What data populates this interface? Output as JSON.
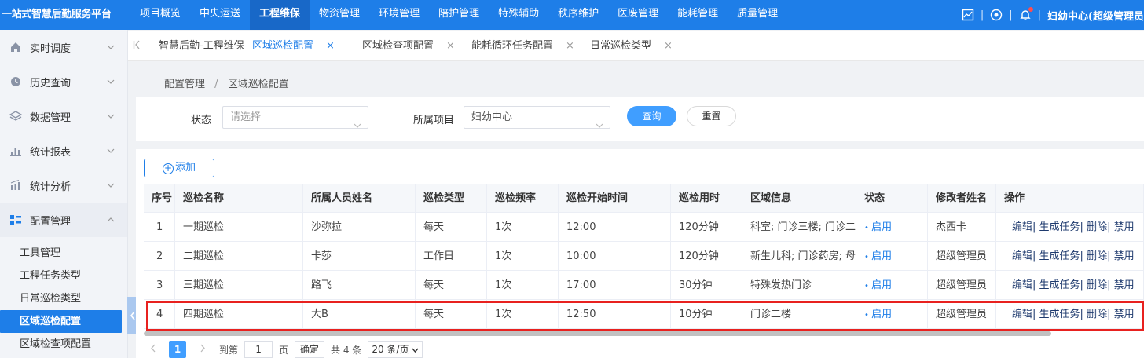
{
  "topbar": {
    "brand": "一站式智慧后勤服务平台",
    "nav": [
      "项目概览",
      "中央运送",
      "工程维保",
      "物资管理",
      "环境管理",
      "陪护管理",
      "特殊辅助",
      "秩序维护",
      "医废管理",
      "能耗管理",
      "质量管理"
    ],
    "active_nav": "工程维保",
    "user_label": "妇幼中心(超级管理员"
  },
  "sidebar": {
    "groups": [
      {
        "label": "实时调度",
        "icon": "home-icon"
      },
      {
        "label": "历史查询",
        "icon": "history-icon"
      },
      {
        "label": "数据管理",
        "icon": "layers-icon"
      },
      {
        "label": "统计报表",
        "icon": "bar-chart-icon"
      },
      {
        "label": "统计分析",
        "icon": "analysis-icon"
      },
      {
        "label": "配置管理",
        "icon": "grid-icon"
      }
    ],
    "sub_items": [
      "工具管理",
      "工程任务类型",
      "日常巡检类型",
      "区域巡检配置",
      "区域检查项配置"
    ],
    "active_sub": "区域巡检配置"
  },
  "tabs": [
    {
      "label": "智慧后勤-工程维保",
      "closable": false
    },
    {
      "label": "区域巡检配置",
      "closable": true,
      "active": true
    },
    {
      "label": "区域检查项配置",
      "closable": true
    },
    {
      "label": "能耗循环任务配置",
      "closable": true
    },
    {
      "label": "日常巡检类型",
      "closable": true
    }
  ],
  "breadcrumb": {
    "parent": "配置管理",
    "separator": "/",
    "current": "区域巡检配置"
  },
  "filter": {
    "status_label": "状态",
    "status_placeholder": "请选择",
    "project_label": "所属项目",
    "project_value": "妇幼中心",
    "query_label": "查询",
    "reset_label": "重置"
  },
  "add_label": "添加",
  "table": {
    "columns": [
      "序号",
      "巡检名称",
      "所属人员姓名",
      "巡检类型",
      "巡检频率",
      "巡检开始时间",
      "巡检用时",
      "区域信息",
      "状态",
      "修改者姓名",
      "操作"
    ],
    "rows": [
      [
        "1",
        "一期巡检",
        "沙弥拉",
        "每天",
        "1次",
        "12:00",
        "120分钟",
        "科室; 门诊三楼; 门诊二楼",
        "启用",
        "杰西卡"
      ],
      [
        "2",
        "二期巡检",
        "卡莎",
        "工作日",
        "1次",
        "10:00",
        "120分钟",
        "新生儿科; 门诊药房; 母婴",
        "启用",
        "超级管理员"
      ],
      [
        "3",
        "三期巡检",
        "路飞",
        "每天",
        "1次",
        "17:00",
        "30分钟",
        "特殊发热门诊",
        "启用",
        "超级管理员"
      ],
      [
        "4",
        "四期巡检",
        "大B",
        "每天",
        "1次",
        "12:50",
        "10分钟",
        "门诊二楼",
        "启用",
        "超级管理员"
      ]
    ],
    "actions": [
      "编辑",
      "生成任务",
      "删除",
      "禁用"
    ]
  },
  "pager": {
    "current_page": "1",
    "goto_label": "到第",
    "page_input": "1",
    "page_unit": "页",
    "confirm_label": "确定",
    "total_label": "共 4 条",
    "page_size": "20 条/页"
  }
}
